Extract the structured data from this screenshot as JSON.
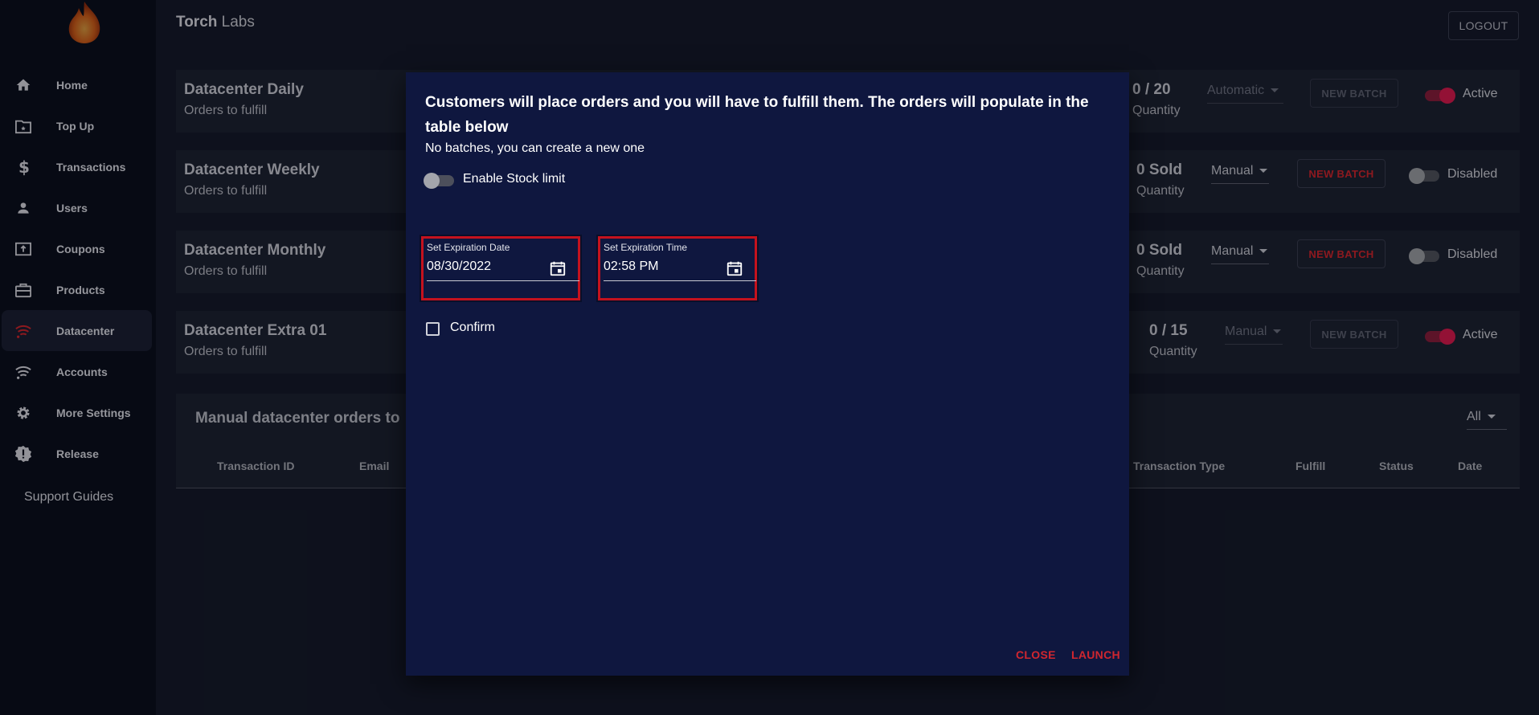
{
  "app": {
    "brand_bold": "Torch",
    "brand_rest": " Labs",
    "logout_label": "LOGOUT"
  },
  "sidebar": {
    "items": [
      {
        "label": "Home",
        "icon": "home-icon"
      },
      {
        "label": "Top Up",
        "icon": "wallet-icon"
      },
      {
        "label": "Transactions",
        "icon": "dollar-icon"
      },
      {
        "label": "Users",
        "icon": "user-icon"
      },
      {
        "label": "Coupons",
        "icon": "coupon-icon"
      },
      {
        "label": "Products",
        "icon": "briefcase-icon"
      },
      {
        "label": "Datacenter",
        "icon": "wifi-icon",
        "active": true
      },
      {
        "label": "Accounts",
        "icon": "wifi-icon"
      },
      {
        "label": "More Settings",
        "icon": "gear-icon"
      },
      {
        "label": "Release",
        "icon": "badge-icon"
      }
    ],
    "support_label": "Support Guides"
  },
  "products": [
    {
      "title": "Datacenter Daily",
      "subtitle": "Orders to fulfill",
      "quantity": "0 / 20",
      "quantity_label": "Quantity",
      "mode": "Automatic",
      "batch_label": "NEW BATCH",
      "status": "Active"
    },
    {
      "title": "Datacenter Weekly",
      "subtitle": "Orders to fulfill",
      "quantity": "0 Sold",
      "quantity_label": "Quantity",
      "mode": "Manual",
      "batch_label": "NEW BATCH",
      "status": "Disabled"
    },
    {
      "title": "Datacenter Monthly",
      "subtitle": "Orders to fulfill",
      "quantity": "0 Sold",
      "quantity_label": "Quantity",
      "mode": "Manual",
      "batch_label": "NEW BATCH",
      "status": "Disabled"
    },
    {
      "title": "Datacenter Extra 01",
      "subtitle": "Orders to fulfill",
      "quantity": "0 / 15",
      "quantity_label": "Quantity",
      "mode": "Manual",
      "batch_label": "NEW BATCH",
      "status": "Active"
    }
  ],
  "orders": {
    "title": "Manual datacenter orders to",
    "filter": "All",
    "columns": [
      "Transaction ID",
      "Email",
      "Transaction Type",
      "Fulfill",
      "Status",
      "Date"
    ]
  },
  "dialog": {
    "heading": "Customers will place orders and you will have to fulfill them. The orders will populate in the table below",
    "subtext": "No batches, you can create a new one",
    "stock_limit_label": "Enable Stock limit",
    "date_label": "Set Expiration Date",
    "date_value": "08/30/2022",
    "time_label": "Set Expiration Time",
    "time_value": "02:58 PM",
    "confirm_label": "Confirm",
    "close_label": "CLOSE",
    "launch_label": "LAUNCH"
  },
  "colors": {
    "accent_red": "#d0262f",
    "toggle_on": "#d91a4f",
    "dialog_bg": "#0f173f",
    "sidebar_bg": "#0b0f1e"
  }
}
